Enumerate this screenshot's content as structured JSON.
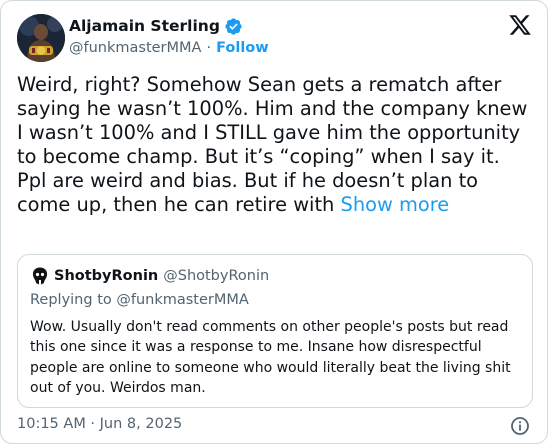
{
  "author": {
    "name": "Aljamain Sterling",
    "handle": "@funkmasterMMA",
    "separator": "·",
    "follow_label": "Follow"
  },
  "tweet": {
    "text": "Weird, right? Somehow Sean gets a rematch after saying he wasn’t 100%. Him and the company knew I wasn’t 100% and I STILL gave him the opportunity to become champ. But it’s “coping” when I say it. Ppl are weird and bias. But if he doesn’t plan to come up, then he can retire with",
    "show_more_label": "Show more"
  },
  "quote": {
    "name": "ShotbyRonin",
    "handle": "@ShotbyRonin",
    "replying_to": "Replying to @funkmasterMMA",
    "text": "Wow. Usually don't read comments on other people's posts but read this one since it was a response to me. Insane how disrespectful people are online to someone who would literally beat the living shit out of you. Weirdos man."
  },
  "timestamp": "10:15 AM · Jun 8, 2025",
  "icons": {
    "verified": "verified-badge-icon",
    "logo": "x-logo-icon",
    "info": "info-icon"
  },
  "colors": {
    "accent": "#1d9bf0",
    "text": "#0f1419",
    "muted": "#536471",
    "border": "#cfd9de"
  }
}
